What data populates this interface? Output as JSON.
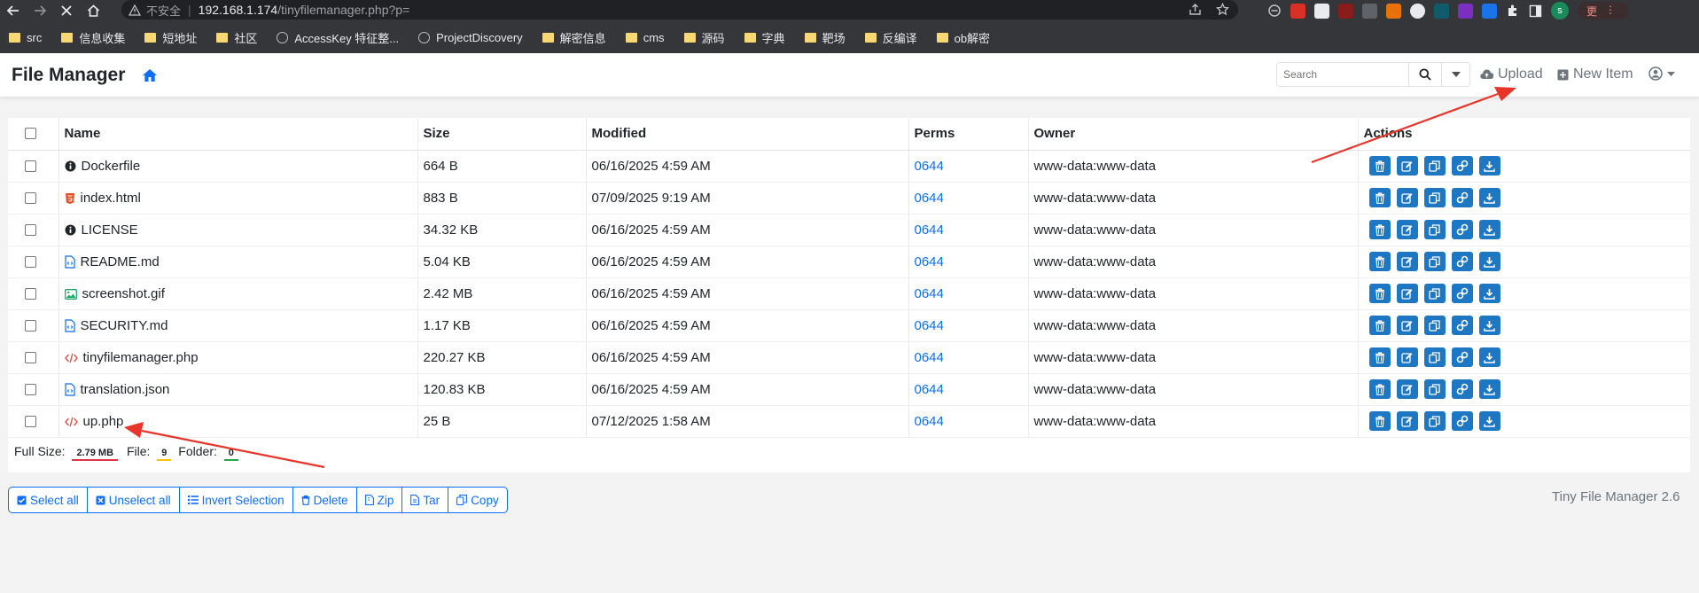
{
  "browser": {
    "insecure_label": "不安全",
    "host": "192.168.1.174",
    "path": "/tinyfilemanager.php?p=",
    "update_label": "更新",
    "profile_initial": "s",
    "bookmarks": [
      {
        "label": "src",
        "icon": "folder"
      },
      {
        "label": "信息收集",
        "icon": "folder"
      },
      {
        "label": "短地址",
        "icon": "folder"
      },
      {
        "label": "社区",
        "icon": "folder"
      },
      {
        "label": "AccessKey 特征整...",
        "icon": "globe"
      },
      {
        "label": "ProjectDiscovery",
        "icon": "globe"
      },
      {
        "label": "解密信息",
        "icon": "folder"
      },
      {
        "label": "cms",
        "icon": "folder"
      },
      {
        "label": "源码",
        "icon": "folder"
      },
      {
        "label": "字典",
        "icon": "folder"
      },
      {
        "label": "靶场",
        "icon": "folder"
      },
      {
        "label": "反编译",
        "icon": "folder"
      },
      {
        "label": "ob解密",
        "icon": "folder"
      }
    ]
  },
  "app": {
    "title": "File Manager",
    "search_placeholder": "Search",
    "upload_label": "Upload",
    "new_item_label": "New Item",
    "version": "Tiny File Manager 2.6"
  },
  "table": {
    "headers": [
      "Name",
      "Size",
      "Modified",
      "Perms",
      "Owner",
      "Actions"
    ],
    "rows": [
      {
        "name": "Dockerfile",
        "icon": "info-icon",
        "size": "664 B",
        "modified": "06/16/2025 4:59 AM",
        "perms": "0644",
        "owner": "www-data:www-data"
      },
      {
        "name": "index.html",
        "icon": "html5-icon",
        "size": "883 B",
        "modified": "07/09/2025 9:19 AM",
        "perms": "0644",
        "owner": "www-data:www-data"
      },
      {
        "name": "LICENSE",
        "icon": "info-icon",
        "size": "34.32 KB",
        "modified": "06/16/2025 4:59 AM",
        "perms": "0644",
        "owner": "www-data:www-data"
      },
      {
        "name": "README.md",
        "icon": "code-file-icon",
        "size": "5.04 KB",
        "modified": "06/16/2025 4:59 AM",
        "perms": "0644",
        "owner": "www-data:www-data"
      },
      {
        "name": "screenshot.gif",
        "icon": "image-icon",
        "size": "2.42 MB",
        "modified": "06/16/2025 4:59 AM",
        "perms": "0644",
        "owner": "www-data:www-data"
      },
      {
        "name": "SECURITY.md",
        "icon": "code-file-icon",
        "size": "1.17 KB",
        "modified": "06/16/2025 4:59 AM",
        "perms": "0644",
        "owner": "www-data:www-data"
      },
      {
        "name": "tinyfilemanager.php",
        "icon": "code-icon",
        "size": "220.27 KB",
        "modified": "06/16/2025 4:59 AM",
        "perms": "0644",
        "owner": "www-data:www-data"
      },
      {
        "name": "translation.json",
        "icon": "code-file-icon",
        "size": "120.83 KB",
        "modified": "06/16/2025 4:59 AM",
        "perms": "0644",
        "owner": "www-data:www-data"
      },
      {
        "name": "up.php",
        "icon": "code-icon",
        "size": "25 B",
        "modified": "07/12/2025 1:58 AM",
        "perms": "0644",
        "owner": "www-data:www-data"
      }
    ],
    "footer": {
      "full_size_label": "Full Size:",
      "full_size": "2.79 MB",
      "file_label": "File:",
      "file_count": "9",
      "folder_label": "Folder:",
      "folder_count": "0"
    }
  },
  "bulk_actions": [
    "Select all",
    "Unselect all",
    "Invert Selection",
    "Delete",
    "Zip",
    "Tar",
    "Copy"
  ],
  "colors": {
    "accent": "#0d6efd",
    "action_button": "#1d77c2",
    "annotation_arrow": "#e8352a"
  }
}
